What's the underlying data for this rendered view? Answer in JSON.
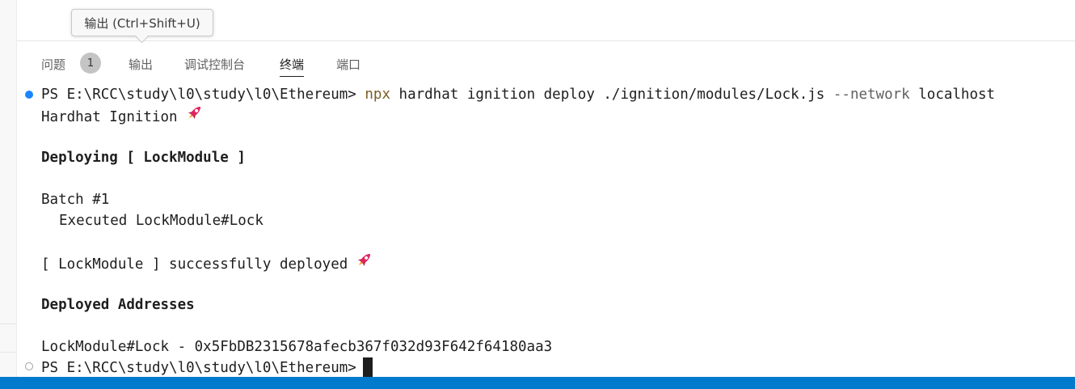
{
  "tooltip": {
    "text": "输出 (Ctrl+Shift+U)"
  },
  "panel": {
    "tabs": [
      {
        "label": "问题",
        "badge": "1"
      },
      {
        "label": "输出"
      },
      {
        "label": "调试控制台"
      },
      {
        "label": "终端",
        "active": true
      },
      {
        "label": "端口"
      }
    ]
  },
  "terminal": {
    "command": {
      "prompt": "PS E:\\RCC\\study\\l0\\study\\l0\\Ethereum>",
      "program": "npx",
      "args": "hardhat ignition deploy ./ignition/modules/Lock.js",
      "flag": "--network",
      "flag_value": "localhost"
    },
    "lines": {
      "banner": "Hardhat Ignition",
      "deploying": "Deploying [ LockModule ]",
      "batch": "Batch #1",
      "executed": "Executed LockModule#Lock",
      "success": "[ LockModule ] successfully deployed",
      "addresses_header": "Deployed Addresses",
      "address": "LockModule#Lock - 0x5FbDB2315678afecb367f032d93F642f64180aa3"
    },
    "final_prompt": "PS E:\\RCC\\study\\l0\\study\\l0\\Ethereum>",
    "icons": {
      "rocket": "rocket-icon"
    }
  },
  "colors": {
    "accent": "#007acc",
    "command": "#795e26",
    "success_marker": "#1a85ff",
    "rocket": "#e0245e"
  }
}
